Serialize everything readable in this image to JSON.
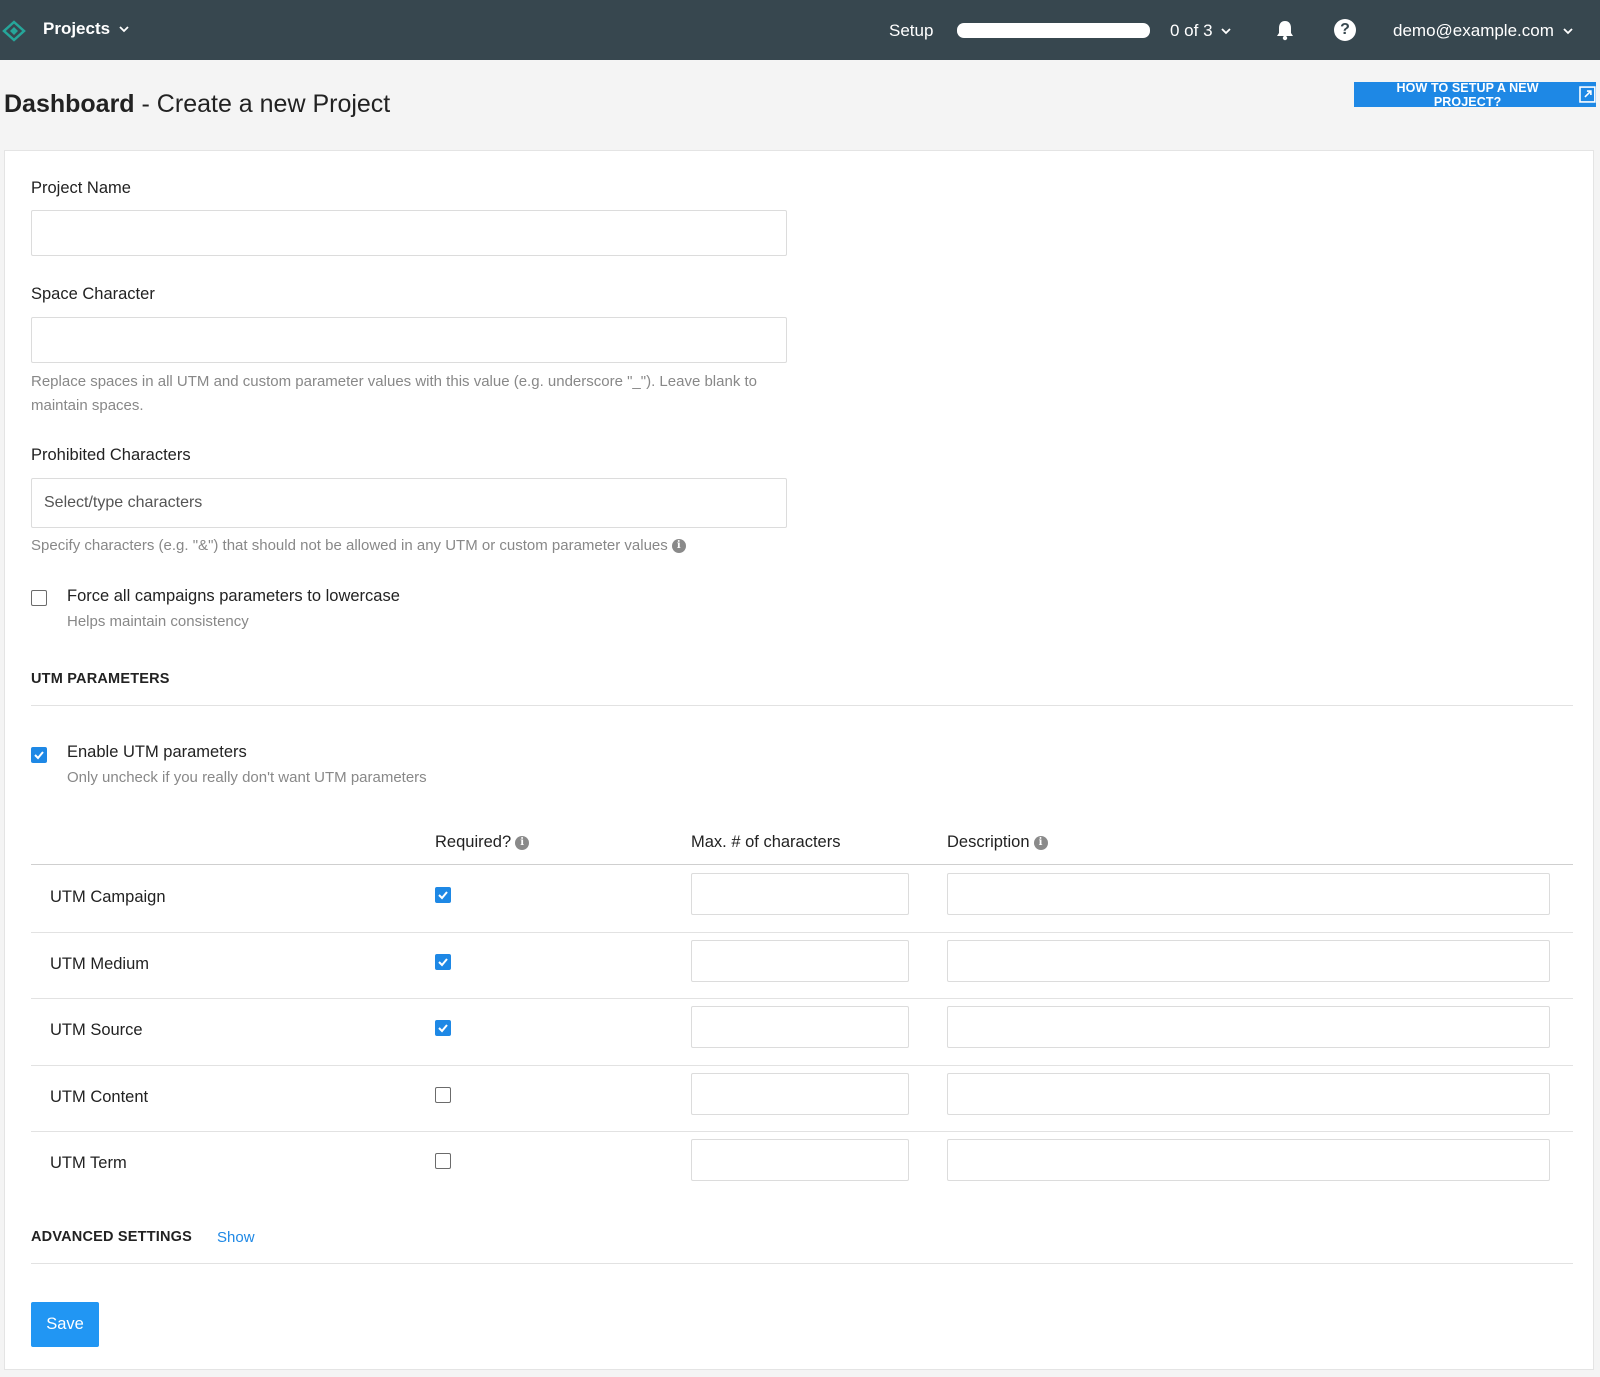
{
  "topbar": {
    "projects_label": "Projects",
    "setup_label": "Setup",
    "setup_progress": 0,
    "steps_label": "0 of 3",
    "user_email": "demo@example.com"
  },
  "page": {
    "title_bold": "Dashboard",
    "title_rest": " - Create a new Project",
    "howto_label": "HOW TO SETUP A NEW PROJECT?"
  },
  "form": {
    "project_name_label": "Project Name",
    "project_name_value": "",
    "space_char_label": "Space Character",
    "space_char_value": "",
    "space_char_hint": "Replace spaces in all UTM and custom parameter values with this value (e.g. underscore \"_\"). Leave blank to maintain spaces.",
    "prohibited_label": "Prohibited Characters",
    "prohibited_placeholder": "Select/type characters",
    "prohibited_hint": "Specify characters (e.g. \"&\") that should not be allowed in any UTM or custom parameter values",
    "lowercase_label": "Force all campaigns parameters to lowercase",
    "lowercase_hint": "Helps maintain consistency",
    "lowercase_checked": false
  },
  "utm": {
    "section_title": "UTM PARAMETERS",
    "enable_label": "Enable UTM parameters",
    "enable_hint": "Only uncheck if you really don't want UTM parameters",
    "enable_checked": true,
    "headers": {
      "required": "Required?",
      "max_chars": "Max. # of characters",
      "description": "Description"
    },
    "rows": [
      {
        "label": "UTM Campaign",
        "required": true
      },
      {
        "label": "UTM Medium",
        "required": true
      },
      {
        "label": "UTM Source",
        "required": true
      },
      {
        "label": "UTM Content",
        "required": false
      },
      {
        "label": "UTM Term",
        "required": false
      }
    ]
  },
  "advanced": {
    "title": "ADVANCED SETTINGS",
    "toggle_label": "Show"
  },
  "actions": {
    "save_label": "Save"
  },
  "colors": {
    "topbar": "#37474f",
    "accent": "#1e88e5",
    "logo": "#26a69a"
  }
}
